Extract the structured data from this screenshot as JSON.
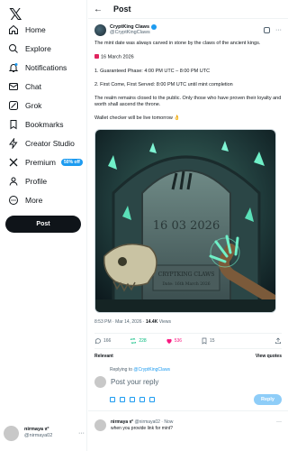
{
  "sidebar": {
    "logo": "𝕏",
    "items": [
      {
        "label": "Home",
        "icon": "home-icon"
      },
      {
        "label": "Explore",
        "icon": "search-icon"
      },
      {
        "label": "Notifications",
        "icon": "bell-icon"
      },
      {
        "label": "Chat",
        "icon": "mail-icon"
      },
      {
        "label": "Grok",
        "icon": "grok-icon"
      },
      {
        "label": "Bookmarks",
        "icon": "bookmark-icon"
      },
      {
        "label": "Creator Studio",
        "icon": "lightning-icon"
      },
      {
        "label": "Premium",
        "icon": "x-icon",
        "badge": "50% off"
      },
      {
        "label": "Profile",
        "icon": "person-icon"
      },
      {
        "label": "More",
        "icon": "more-circle-icon"
      }
    ],
    "post_button": "Post",
    "account": {
      "display_name": "nirmaya 𝔫°",
      "handle": "@nirmaya02",
      "more": "···"
    }
  },
  "header": {
    "back": "←",
    "title": "Post"
  },
  "tweet": {
    "display_name": "CryptKing Claws",
    "handle": "@CryptKingClaws",
    "lines": [
      "The mint date was always carved in stone by the claws of the ancient kings.",
      "16 March 2026",
      "1. Guaranteed Phase: 4:00 PM UTC – 8:00 PM UTC",
      "2. First Come, First Served: 8:00 PM UTC until mint completion",
      "The realm remains closed to the public. Only those who have proven their loyalty and worth shall ascend the throne.",
      "Wallet checker will be live tomorrow 👌"
    ],
    "image": {
      "date_text": "16 03 2026",
      "plaque_title": "CRYPTKING CLAWS",
      "plaque_sub": "Date: 16th March 2026"
    },
    "time": "8:53 PM · Mar 14, 2026 · ",
    "views_count": "14.4K",
    "views_label": " Views",
    "stats": {
      "replies": "166",
      "reposts": "228",
      "likes": "536",
      "bookmarks": "15"
    }
  },
  "sort": {
    "left": "Relevant",
    "right": "View quotes"
  },
  "composer": {
    "replying_prefix": "Replying to ",
    "replying_handle": "@CryptKingClaws",
    "placeholder": "Post your reply",
    "reply_button": "Reply"
  },
  "reply": {
    "display_name": "nirmaya 𝔫°",
    "handle": "@nirmaya02 · Now",
    "text": "when you provide link for mint?",
    "more": "···"
  },
  "colors": {
    "accent": "#1d9bf0",
    "like": "#f91880",
    "repost": "#00ba7c",
    "text": "#0f1419",
    "muted": "#536471"
  }
}
